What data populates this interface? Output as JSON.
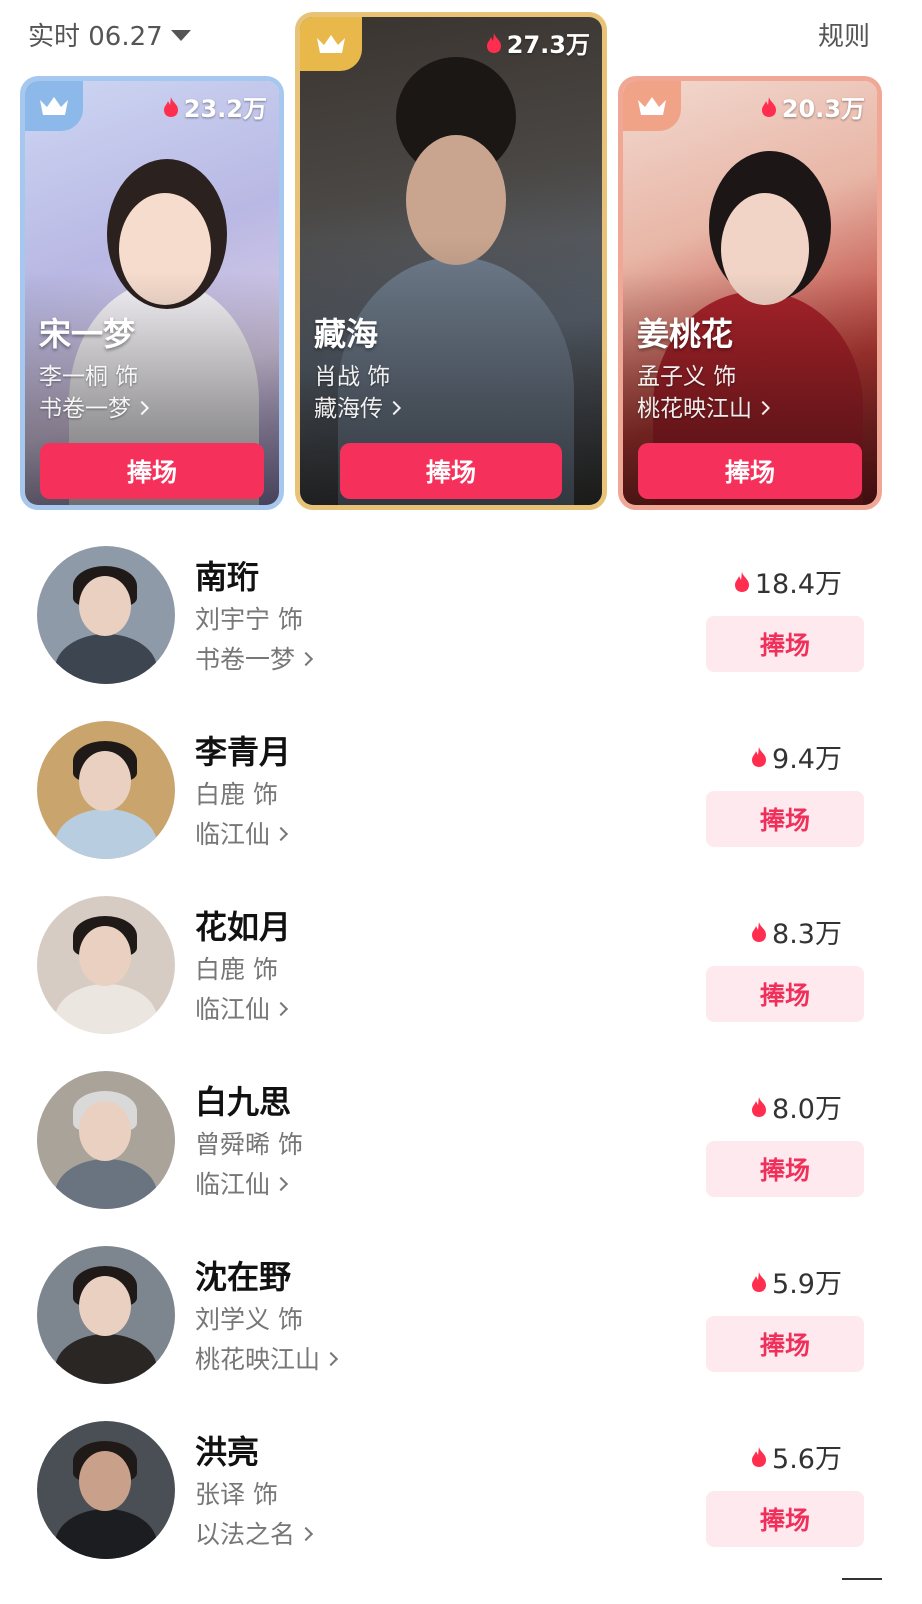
{
  "header": {
    "time_label": "实时 06.27",
    "rules_label": "规则"
  },
  "colors": {
    "accent": "#f5305a",
    "support_light_bg": "#fde9ee",
    "gold": "#e8c377",
    "silver_blue": "#a7c8ee",
    "bronze": "#f0a795"
  },
  "top3": [
    {
      "rank": 2,
      "heat": "23.2万",
      "character": "宋一梦",
      "actor": "李一桐 饰",
      "drama": "书卷一梦",
      "button": "捧场"
    },
    {
      "rank": 1,
      "heat": "27.3万",
      "character": "藏海",
      "actor": "肖战 饰",
      "drama": "藏海传",
      "button": "捧场"
    },
    {
      "rank": 3,
      "heat": "20.3万",
      "character": "姜桃花",
      "actor": "孟子义 饰",
      "drama": "桃花映江山",
      "button": "捧场"
    }
  ],
  "list": [
    {
      "character": "南珩",
      "actor": "刘宇宁 饰",
      "drama": "书卷一梦",
      "heat": "18.4万",
      "button": "捧场"
    },
    {
      "character": "李青月",
      "actor": "白鹿 饰",
      "drama": "临江仙",
      "heat": "9.4万",
      "button": "捧场"
    },
    {
      "character": "花如月",
      "actor": "白鹿 饰",
      "drama": "临江仙",
      "heat": "8.3万",
      "button": "捧场"
    },
    {
      "character": "白九思",
      "actor": "曾舜晞 饰",
      "drama": "临江仙",
      "heat": "8.0万",
      "button": "捧场"
    },
    {
      "character": "沈在野",
      "actor": "刘学义 饰",
      "drama": "桃花映江山",
      "heat": "5.9万",
      "button": "捧场"
    },
    {
      "character": "洪亮",
      "actor": "张译 饰",
      "drama": "以法之名",
      "heat": "5.6万",
      "button": "捧场"
    }
  ]
}
